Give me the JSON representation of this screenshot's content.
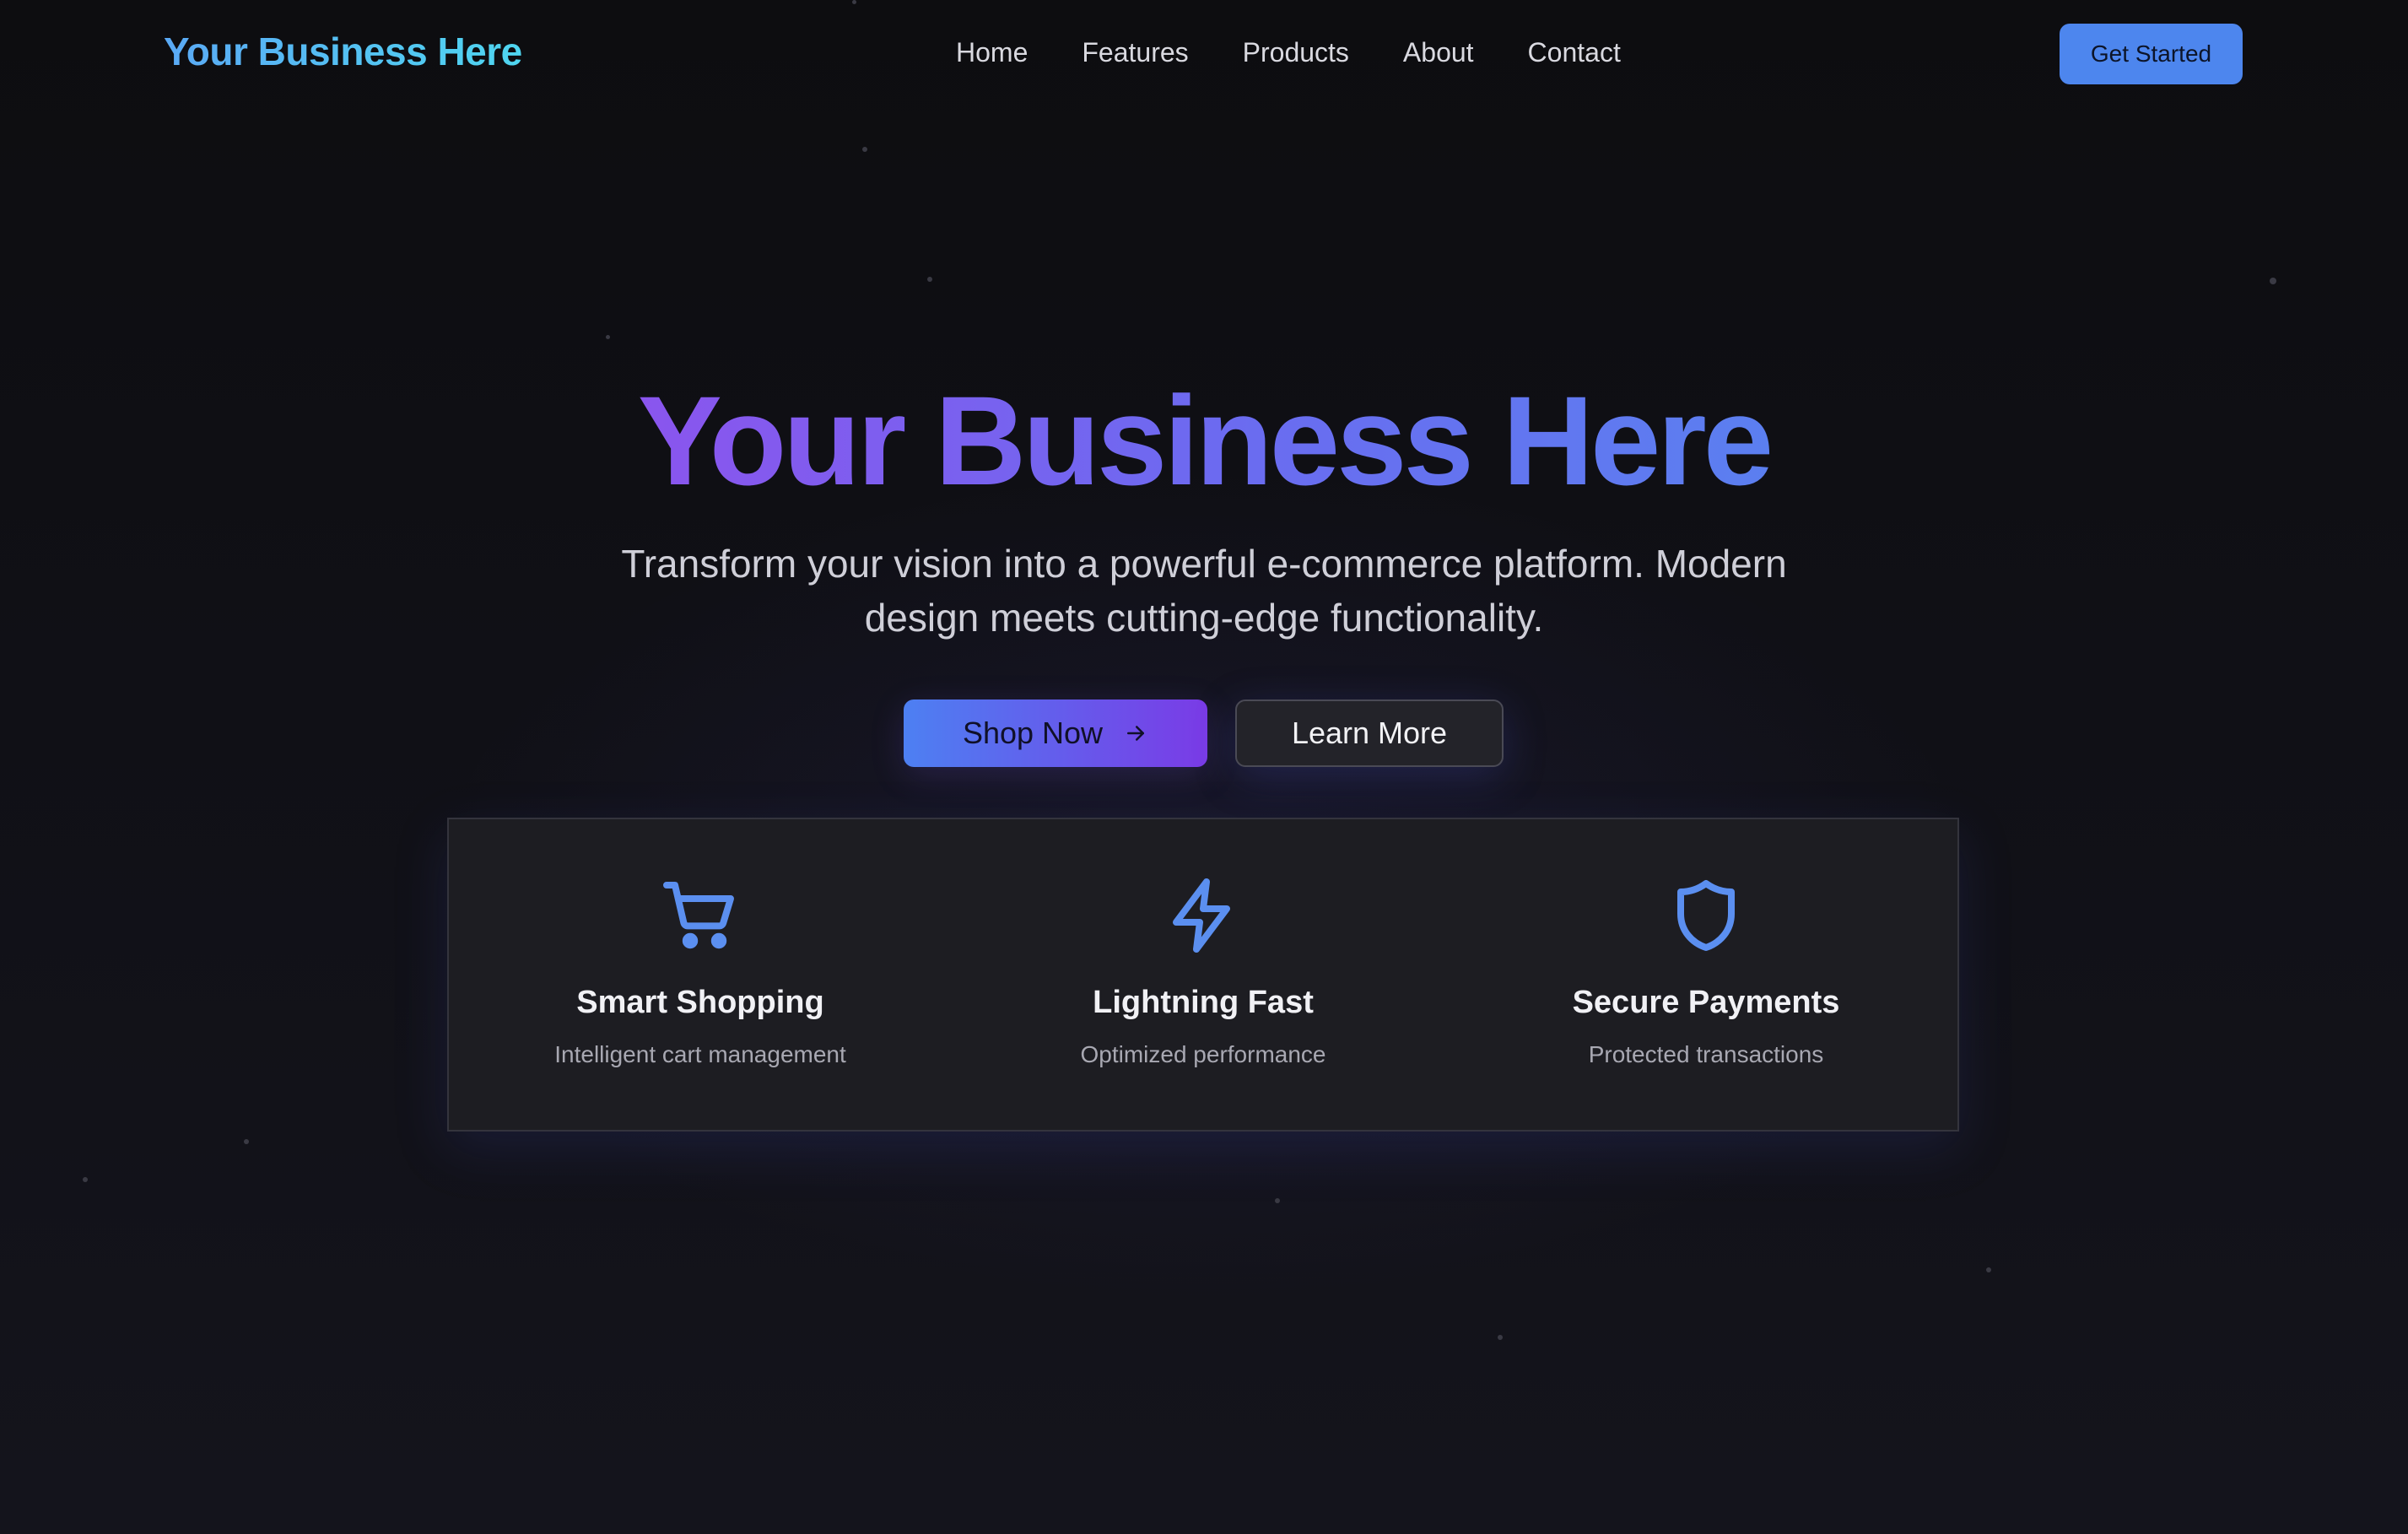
{
  "nav": {
    "logo": "Your Business Here",
    "links": [
      "Home",
      "Features",
      "Products",
      "About",
      "Contact"
    ],
    "cta": "Get Started"
  },
  "hero": {
    "title": "Your Business Here",
    "subtitle_line1": "Transform your vision into a powerful e-commerce platform. Modern",
    "subtitle_line2": "design meets cutting-edge functionality.",
    "primary_button": "Shop Now",
    "secondary_button": "Learn More"
  },
  "features": [
    {
      "icon": "shopping-cart-icon",
      "title": "Smart Shopping",
      "description": "Intelligent cart management"
    },
    {
      "icon": "lightning-icon",
      "title": "Lightning Fast",
      "description": "Optimized performance"
    },
    {
      "icon": "shield-icon",
      "title": "Secure Payments",
      "description": "Protected transactions"
    }
  ],
  "colors": {
    "accent_blue": "#4d86ee",
    "accent_purple": "#7a3be6",
    "icon_blue": "#5b8ff0",
    "background": "#0d0d10"
  }
}
